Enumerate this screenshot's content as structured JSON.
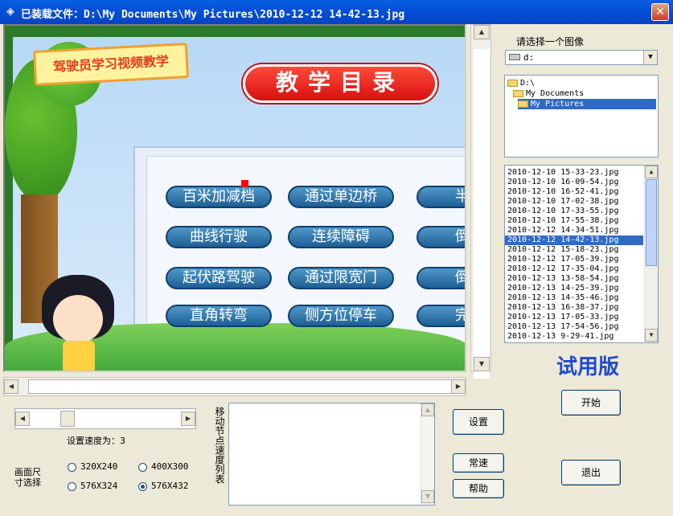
{
  "window": {
    "title": "已装载文件：D:\\My Documents\\My Pictures\\2010-12-12 14-42-13.jpg",
    "close_glyph": "✕",
    "icon_glyph": "◈"
  },
  "icons": [
    "app-icon",
    "close-icon",
    "drive-icon",
    "folder-icon",
    "arrow-up-icon",
    "arrow-down-icon",
    "arrow-left-icon",
    "arrow-right-icon"
  ],
  "preview": {
    "logo": "驾驶员学习视频教学",
    "banner": "教学目录",
    "lessons": [
      [
        "百米加减档",
        "通过单边桥",
        "半坡"
      ],
      [
        "曲线行驶",
        "连续障碍",
        "倒杆"
      ],
      [
        "起伏路驾驶",
        "通过限宽门",
        "倒桩"
      ],
      [
        "直角转弯",
        "侧方位停车",
        "完美"
      ]
    ]
  },
  "scroll_arrows": {
    "up": "▲",
    "down": "▼",
    "left": "◀",
    "right": "▶"
  },
  "right_panel": {
    "select_image_label": "请选择一个图像",
    "drive_value": "d:",
    "dir_tree": [
      "D:\\",
      "My Documents",
      "My Pictures"
    ],
    "selected_dir": "My Pictures",
    "files": [
      "2010-12-10 15-33-23.jpg",
      "2010-12-10 16-09-54.jpg",
      "2010-12-10 16-52-41.jpg",
      "2010-12-10 17-02-38.jpg",
      "2010-12-10 17-33-55.jpg",
      "2010-12-10 17-55-38.jpg",
      "2010-12-12 14-34-51.jpg",
      "2010-12-12 14-42-13.jpg",
      "2010-12-12 15-18-23.jpg",
      "2010-12-12 17-05-39.jpg",
      "2010-12-12 17-35-04.jpg",
      "2010-12-13 13-58-54.jpg",
      "2010-12-13 14-25-39.jpg",
      "2010-12-13 14-35-46.jpg",
      "2010-12-13 16-38-37.jpg",
      "2010-12-13 17-05-33.jpg",
      "2010-12-13 17-54-56.jpg",
      "2010-12-13 9-29-41.jpg"
    ],
    "selected_file": "2010-12-12 14-42-13.jpg",
    "trial_label": "试用版",
    "start_button": "开始",
    "exit_button": "退出"
  },
  "bottom": {
    "speed_label": "设置速度为：3",
    "size_label_line1": "画面尺",
    "size_label_line2": "寸选择",
    "sizes": [
      {
        "label": "320X240",
        "checked": false
      },
      {
        "label": "400X300",
        "checked": false
      },
      {
        "label": "576X324",
        "checked": false
      },
      {
        "label": "576X432",
        "checked": true
      }
    ],
    "move_list_label": "移动节点速度列表",
    "settings_button": "设置",
    "normal_speed_button": "常速",
    "help_button": "帮助"
  }
}
